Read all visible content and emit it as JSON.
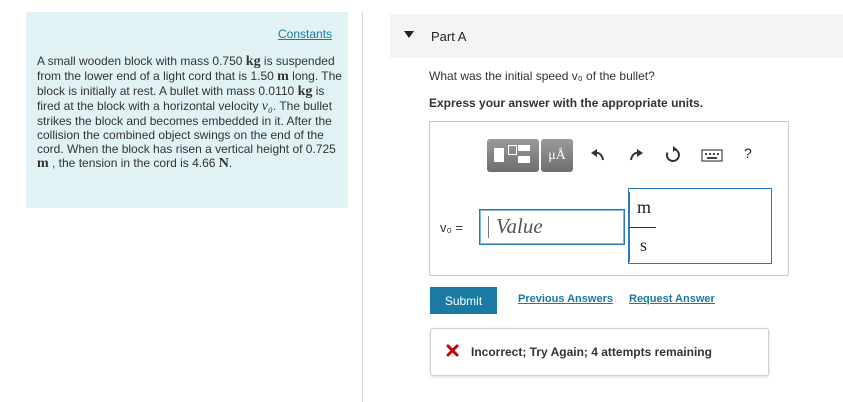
{
  "sidebar": {
    "constants_link": "Constants",
    "problem": {
      "t1": "A small wooden block with mass 0.750 ",
      "u_kg": "kg",
      "t2": " is suspended from the lower end of a light cord that is 1.50 ",
      "u_m": "m",
      "t3": " long. The block is initially at rest. A bullet with mass 0.0110 ",
      "u_kg2": "kg",
      "t4": " is fired at the block with a horizontal velocity ",
      "v0": "v₀",
      "t5": ". The bullet strikes the block and becomes embedded in it. After the collision the combined object swings on the end of the cord. When the block has risen a vertical height of 0.725 ",
      "u_m2": "m",
      "t6": " , the tension in the cord is 4.66 ",
      "u_N": "N",
      "t7": "."
    }
  },
  "part": {
    "title": "Part A",
    "question": "What was the initial speed v₀ of the bullet?",
    "instruction": "Express your answer with the appropriate units."
  },
  "toolbar": {
    "units_label": "μÅ",
    "help_label": "?",
    "icons": [
      "templates-icon",
      "units-icon",
      "undo-icon",
      "redo-icon",
      "reset-icon",
      "keyboard-icon",
      "help-icon"
    ]
  },
  "answer": {
    "variable_label": "v₀ =",
    "value_placeholder": "Value",
    "unit_numerator": "m",
    "unit_denominator": "s"
  },
  "actions": {
    "submit": "Submit",
    "previous_answers": "Previous Answers",
    "request_answer": "Request Answer"
  },
  "feedback": {
    "status": "Incorrect; Try Again; 4 attempts remaining",
    "status_color": "#cc0000"
  },
  "colors": {
    "panel_bg": "#e0f2f4",
    "accent": "#1b7aa3",
    "link": "#1a7aa0"
  }
}
